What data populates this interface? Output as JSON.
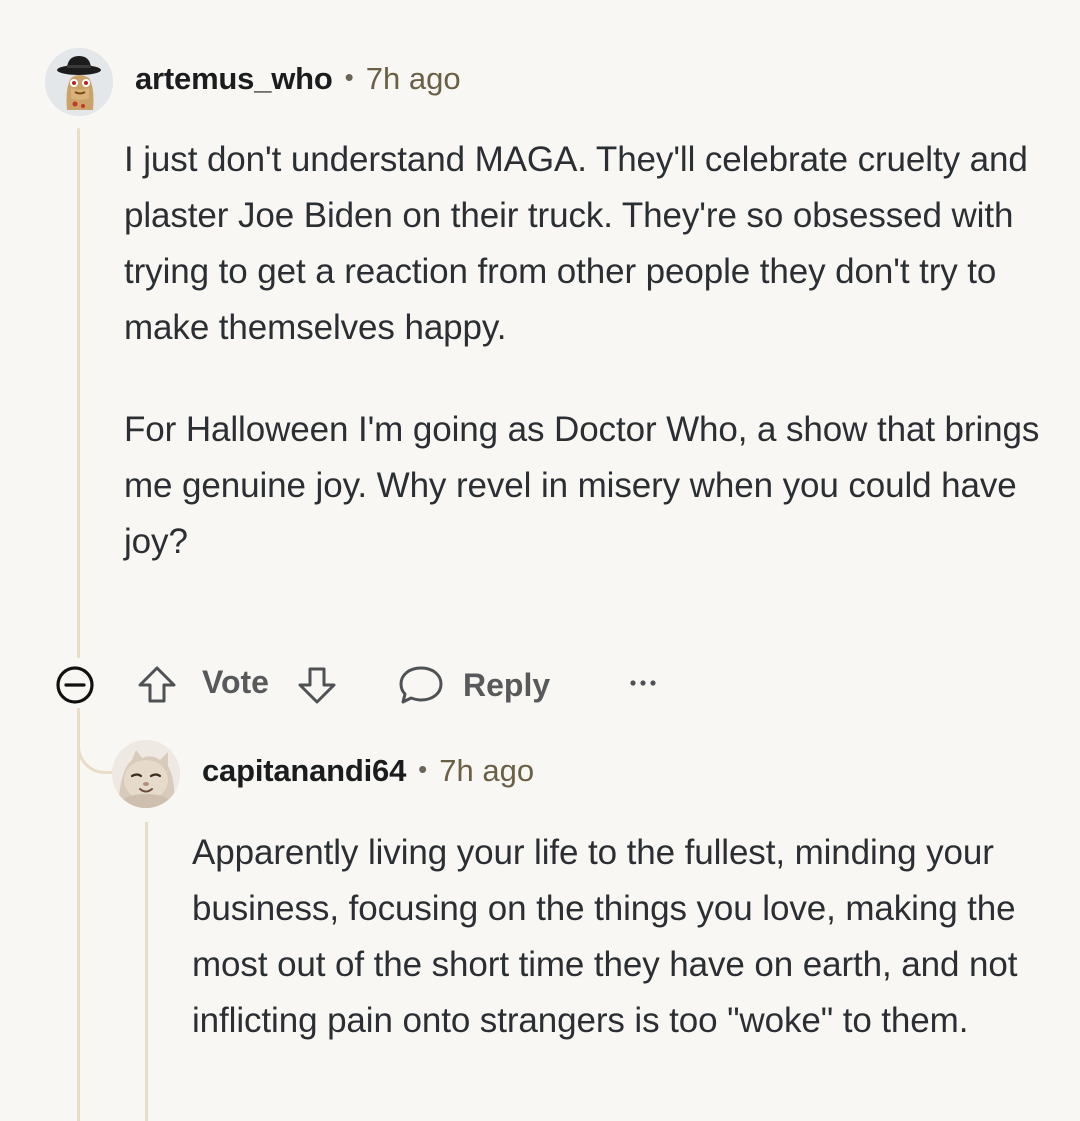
{
  "comment": {
    "username": "artemus_who",
    "separator": "•",
    "time": "7h ago",
    "paragraphs": [
      "I just don't understand MAGA. They'll celebrate cruelty and plaster Joe Biden on their truck. They're so obsessed with trying to get a reaction from other people they don't try to make themselves happy.",
      "For Halloween I'm going as Doctor Who, a show that brings me genuine joy. Why revel in misery when you could have joy?"
    ],
    "avatar_icon": "cartoon-avatar-with-hat-icon"
  },
  "actions": {
    "vote_label": "Vote",
    "reply_label": "Reply",
    "more_icon": "ellipsis-icon",
    "collapse_icon": "minus-circle-icon"
  },
  "reply": {
    "username": "capitanandi64",
    "separator": "•",
    "time": "7h ago",
    "text": "Apparently living your life to the fullest, minding your business, focusing on the things you love, making the most out of the short time they have on earth, and not inflicting pain onto strangers is too \"woke\" to them.",
    "avatar_icon": "cat-photo-avatar-icon"
  },
  "colors": {
    "background": "#f8f7f3",
    "thread_line": "#e8ddc6",
    "username": "#1a1c1e",
    "timestamp": "#6b6046",
    "body_text": "#2b2f33",
    "action_text": "#57595b"
  }
}
